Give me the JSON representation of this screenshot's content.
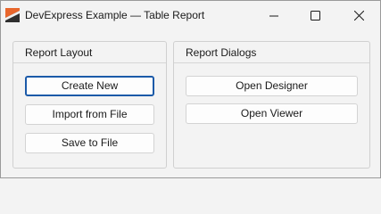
{
  "window": {
    "title": "DevExpress Example — Table Report",
    "icon": "devexpress-logo-icon",
    "controls": {
      "minimize_icon": "minimize-icon",
      "maximize_icon": "maximize-icon",
      "close_icon": "close-icon"
    }
  },
  "report_layout": {
    "header": "Report Layout",
    "buttons": {
      "create_new": "Create New",
      "import_from_file": "Import from File",
      "save_to_file": "Save to File"
    },
    "focused_button": "Create New"
  },
  "report_dialogs": {
    "header": "Report Dialogs",
    "buttons": {
      "open_designer": "Open Designer",
      "open_viewer": "Open Viewer"
    }
  },
  "colors": {
    "window_background": "#f3f3f3",
    "focus_border": "#1b5aa8",
    "logo_orange": "#e8662c",
    "logo_dark": "#2f2f2f"
  }
}
